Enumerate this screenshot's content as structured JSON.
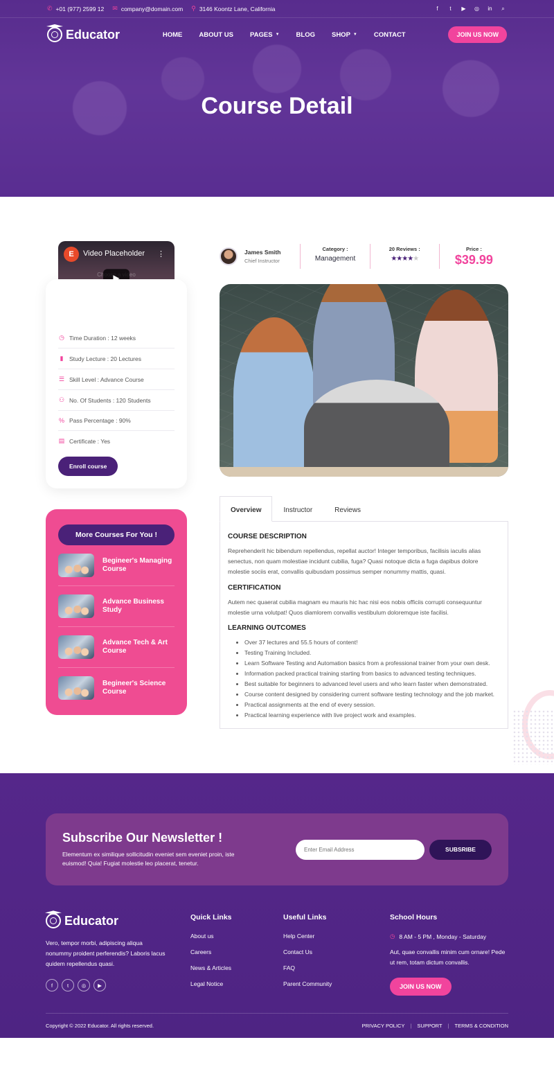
{
  "topbar": {
    "phone": "+01 (977) 2599 12",
    "email": "company@domain.com",
    "address": "3146 Koontz Lane, California",
    "social_icons": [
      "facebook-icon",
      "twitter-icon",
      "youtube-icon",
      "instagram-icon",
      "linkedin-icon",
      "search-icon"
    ]
  },
  "nav": {
    "logo_text": "Educator",
    "items": [
      {
        "label": "HOME"
      },
      {
        "label": "ABOUT US"
      },
      {
        "label": "PAGES"
      },
      {
        "label": "BLOG"
      },
      {
        "label": "SHOP"
      },
      {
        "label": "CONTACT"
      }
    ],
    "cta": "JOIN US NOW"
  },
  "hero": {
    "title": "Course Detail"
  },
  "sidebar": {
    "video": {
      "title": "Video Placeholder",
      "sub": "Choose a video"
    },
    "info": [
      {
        "icon": "clock-icon",
        "text": "Time Duration : 12 weeks"
      },
      {
        "icon": "book-icon",
        "text": "Study Lecture : 20 Lectures"
      },
      {
        "icon": "list-icon",
        "text": "Skill Level : Advance Course"
      },
      {
        "icon": "users-icon",
        "text": "No. Of Students : 120 Students"
      },
      {
        "icon": "percent-icon",
        "text": "Pass Percentage : 90%"
      },
      {
        "icon": "certificate-icon",
        "text": "Certificate : Yes"
      }
    ],
    "enroll": "Enroll course",
    "more_title": "More Courses For You !",
    "more_courses": [
      {
        "title": "Begineer's Managing Course"
      },
      {
        "title": "Advance Business Study"
      },
      {
        "title": "Advance Tech & Art Course"
      },
      {
        "title": "Begineer's Science Course"
      }
    ]
  },
  "course": {
    "author_name": "James Smith",
    "author_role": "Chief Instructor",
    "category_label": "Category :",
    "category": "Management",
    "reviews_label": "20 Reviews :",
    "rating": 4,
    "rating_max": 5,
    "price_label": "Price :",
    "price": "$39.99"
  },
  "tabs": {
    "items": [
      {
        "label": "Overview"
      },
      {
        "label": "Instructor"
      },
      {
        "label": "Reviews"
      }
    ],
    "active": 0
  },
  "overview": {
    "desc_heading": "COURSE DESCRIPTION",
    "desc_text": "Reprehenderit hic bibendum repellendus, repellat auctor! Integer temporibus, facilisis iaculis alias senectus, non quam molestiae incidunt cubilia, fuga? Quasi notoque dicta a fuga dapibus dolore molestie sociis erat, convallis quibusdam possimus semper nonummy mattis, quasi.",
    "cert_heading": "CERTIFICATION",
    "cert_text": "Autem nec quaerat cubilia magnam eu mauris hic hac nisi eos nobis officiis corrupti consequuntur molestie urna volutpat! Quos diamlorem convallis vestibulum doloremque iste facilisi.",
    "outcomes_heading": "LEARNING OUTCOMES",
    "outcomes": [
      "Over 37 lectures and 55.5 hours of content!",
      "Testing Training Included.",
      "Learn Software Testing and Automation basics from a professional trainer from your own desk.",
      "Information packed practical training starting from basics to advanced testing techniques.",
      "Best suitable for beginners to advanced level users and who learn faster when demonstrated.",
      "Course content designed by considering current software testing technology and the job market.",
      "Practical assignments at the end of every session.",
      "Practical learning experience with live project work and examples."
    ]
  },
  "newsletter": {
    "title": "Subscribe Our Newsletter !",
    "text": "Elementum ex similique sollicitudin eveniet sem eveniet proin, iste euismod! Quia! Fugiat molestie leo placerat, tenetur.",
    "placeholder": "Enter Email Address",
    "button": "SUBSRIBE"
  },
  "footer": {
    "logo_text": "Educator",
    "about": "Vero, tempor morbi, adipiscing aliqua nonummy proident perferendis? Laboris lacus quidem repellendus quasi.",
    "social_icons": [
      "facebook-icon",
      "twitter-icon",
      "instagram-icon",
      "youtube-icon"
    ],
    "quick_title": "Quick Links",
    "quick_links": [
      "About us",
      "Careers",
      "News & Articles",
      "Legal Notice"
    ],
    "useful_title": "Useful Links",
    "useful_links": [
      "Help Center",
      "Contact Us",
      "FAQ",
      "Parent Community"
    ],
    "hours_title": "School Hours",
    "hours_time": "8 AM - 5 PM , Monday - Saturday",
    "hours_desc": "Aut, quae convallis minim cum ornare! Pede ut rem, totam dictum convallis.",
    "cta": "JOIN US NOW",
    "copyright": "Copyright © 2022 Educator. All rights reserved.",
    "bottom_links": [
      "PRIVACY POLICY",
      "SUPPORT",
      "TERMS & CONDITION"
    ]
  },
  "colors": {
    "brand_purple": "#4a2178",
    "accent_pink": "#f1449d"
  }
}
